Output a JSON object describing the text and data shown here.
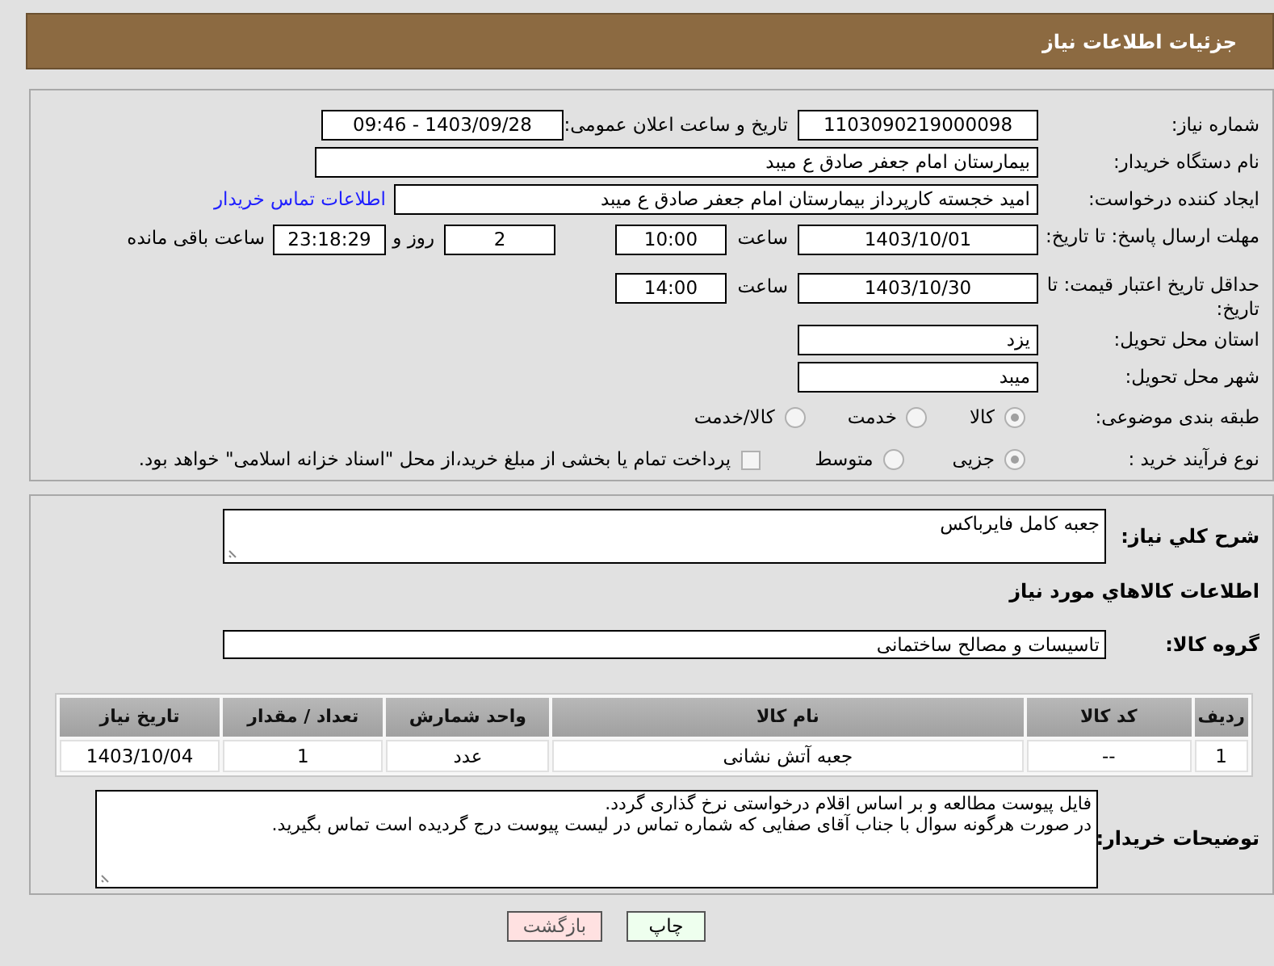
{
  "header": {
    "title": "جزئیات اطلاعات نیاز"
  },
  "need_number": {
    "label": "شماره نیاز:",
    "value": "1103090219000098"
  },
  "announce": {
    "label": "تاریخ و ساعت اعلان عمومی:",
    "value": "1403/09/28 - 09:46"
  },
  "buyer_org": {
    "label": "نام دستگاه خریدار:",
    "value": "بیمارستان امام جعفر صادق  ع  میبد"
  },
  "requester": {
    "label": "ایجاد کننده درخواست:",
    "value": "امید خجسته کارپرداز بیمارستان امام جعفر صادق  ع  میبد",
    "link": "اطلاعات تماس خریدار"
  },
  "response_deadline": {
    "label": "مهلت ارسال پاسخ: تا تاریخ:",
    "date": "1403/10/01",
    "time_label": "ساعت",
    "time": "10:00",
    "days": "2",
    "days_label": "روز و",
    "remaining": "23:18:29",
    "remaining_label": "ساعت باقی مانده"
  },
  "price_validity": {
    "label": "حداقل تاریخ اعتبار قیمت: تا تاریخ:",
    "date": "1403/10/30",
    "time_label": "ساعت",
    "time": "14:00"
  },
  "province": {
    "label": "استان محل تحویل:",
    "value": "یزد"
  },
  "city": {
    "label": "شهر محل تحویل:",
    "value": "میبد"
  },
  "category": {
    "label": "طبقه بندی موضوعی:",
    "options": [
      {
        "label": "کالا",
        "selected": true
      },
      {
        "label": "خدمت",
        "selected": false
      },
      {
        "label": "کالا/خدمت",
        "selected": false
      }
    ]
  },
  "process": {
    "label": "نوع فرآیند خرید :",
    "options": [
      {
        "label": "جزیی",
        "selected": true
      },
      {
        "label": "متوسط",
        "selected": false
      }
    ],
    "payment": {
      "label": "پرداخت تمام یا بخشی از مبلغ خرید،از محل \"اسناد خزانه اسلامی\" خواهد بود.",
      "checked": false
    }
  },
  "description": {
    "label": "شرح کلي نياز:",
    "value": "جعبه کامل فایرباکس"
  },
  "goods_title": "اطلاعات کالاهاي مورد نياز",
  "goods_group": {
    "label": "گروه کالا:",
    "value": "تاسیسات و مصالح ساختمانی"
  },
  "table": {
    "columns": [
      "ردیف",
      "کد کالا",
      "نام کالا",
      "واحد شمارش",
      "تعداد / مقدار",
      "تاریخ نیاز"
    ],
    "rows": [
      [
        "1",
        "--",
        "جعبه آتش نشانی",
        "عدد",
        "1",
        "1403/10/04"
      ]
    ]
  },
  "notes": {
    "label": "توضیحات خریدار:",
    "lines": [
      "فایل پیوست مطالعه و بر اساس اقلام درخواستی نرخ گذاری گردد.",
      "در صورت هرگونه سوال با جناب آقای صفایی که شماره تماس در لیست پیوست درج گردیده است تماس بگیرید."
    ]
  },
  "buttons": [
    {
      "label": "چاپ",
      "kind": "print"
    },
    {
      "label": "بازگشت",
      "kind": "back"
    }
  ]
}
